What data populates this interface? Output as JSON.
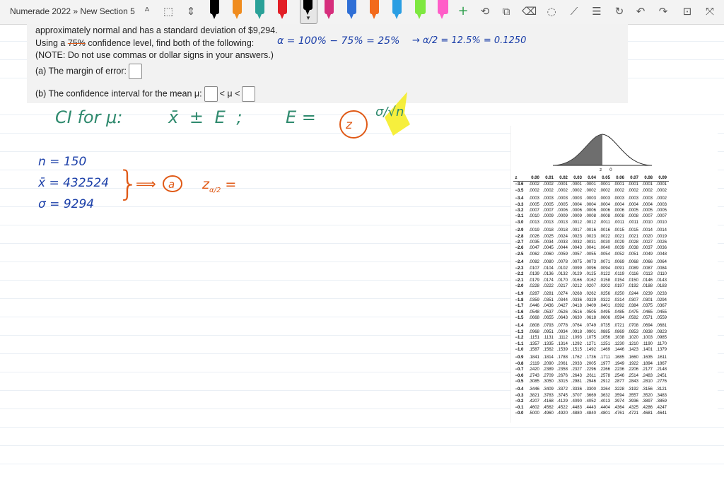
{
  "app": {
    "breadcrumb": "Numerade 2022 » New Section 5"
  },
  "toolbar": {
    "icons": [
      "lasso-text-icon",
      "lasso-select-icon",
      "insert-space-icon",
      "pen-black",
      "pen-orange",
      "pen-teal",
      "pen-red",
      "pen-blue",
      "pen-orange-2",
      "pen-gray",
      "pen-black-selected",
      "pen-red-2",
      "pen-blue-2",
      "highlighter-yellow",
      "highlighter-green",
      "highlighter-pink",
      "add-pen-icon",
      "ink-to-shape-icon",
      "ink-to-text-icon",
      "eraser-icon",
      "ruler-icon",
      "immersive-reader-icon",
      "ink-replay-icon",
      "undo-icon",
      "redo-icon",
      "ink-to-math-icon",
      "fullscreen-icon"
    ],
    "colors": {
      "pen_black": "#000000",
      "pen_orange": "#f08c1e",
      "pen_teal": "#2aa198",
      "pen_red": "#e21e26",
      "pen_blue": "#2f6fd6",
      "pen_orange2": "#f26a1b",
      "pen_gray": "#8c8c8c",
      "pen_selected": "#000000",
      "pen_red2": "#d62e7c",
      "pen_blue2": "#2a9ee3",
      "hl_yellow": "#f5ec1b",
      "hl_green": "#7ee840",
      "hl_pink": "#ff5ec8"
    }
  },
  "problem": {
    "line1": "approximately normal and has a standard deviation of $9,294.",
    "line2_pre": "Using a ",
    "line2_pct": "75%",
    "line2_post": " confidence level, find both of the following:",
    "line3": "(NOTE: Do not use commas or dollar signs in your answers.)",
    "part_a": "(a) The margin of error:",
    "part_b_pre": "(b) The confidence interval for the mean μ:",
    "lt1": "<",
    "mu": "μ",
    "lt2": "<"
  },
  "handwriting": {
    "alpha_line": "α = 100% − 75% = 25%",
    "alpha_half": "→ α/2 = 12.5% = 0.1250",
    "ci_label": "CI for μ:",
    "ci_formula": "x̄ ± E ;",
    "e_eq": "E =",
    "z_circled": "z",
    "sigma_over_root_n": "σ/√n",
    "n_line": "n = 150",
    "xbar_line": "x̄ = 432524",
    "sigma_line": "σ = 9294",
    "implies": "⟹",
    "part_a_circle": "a",
    "z_half": "z",
    "z_sub": "α/2",
    "z_eq": "="
  },
  "ztable": {
    "headers": [
      "z",
      "0.00",
      "0.01",
      "0.02",
      "0.03",
      "0.04",
      "0.05",
      "0.06",
      "0.07",
      "0.08",
      "0.09"
    ],
    "rows": [
      [
        "−3.6",
        ".0002",
        ".0002",
        ".0001",
        ".0001",
        ".0001",
        ".0001",
        ".0001",
        ".0001",
        ".0001",
        ".0001"
      ],
      [
        "−3.5",
        ".0002",
        ".0002",
        ".0002",
        ".0002",
        ".0002",
        ".0002",
        ".0002",
        ".0002",
        ".0002",
        ".0002"
      ],
      [
        "−3.4",
        ".0003",
        ".0003",
        ".0003",
        ".0003",
        ".0003",
        ".0003",
        ".0003",
        ".0003",
        ".0003",
        ".0002"
      ],
      [
        "−3.3",
        ".0005",
        ".0005",
        ".0005",
        ".0004",
        ".0004",
        ".0004",
        ".0004",
        ".0004",
        ".0004",
        ".0003"
      ],
      [
        "−3.2",
        ".0007",
        ".0007",
        ".0006",
        ".0006",
        ".0006",
        ".0006",
        ".0006",
        ".0005",
        ".0005",
        ".0005"
      ],
      [
        "−3.1",
        ".0010",
        ".0009",
        ".0009",
        ".0009",
        ".0008",
        ".0008",
        ".0008",
        ".0008",
        ".0007",
        ".0007"
      ],
      [
        "−3.0",
        ".0013",
        ".0013",
        ".0013",
        ".0012",
        ".0012",
        ".0011",
        ".0011",
        ".0011",
        ".0010",
        ".0010"
      ],
      [
        "−2.9",
        ".0019",
        ".0018",
        ".0018",
        ".0017",
        ".0016",
        ".0016",
        ".0015",
        ".0015",
        ".0014",
        ".0014"
      ],
      [
        "−2.8",
        ".0026",
        ".0025",
        ".0024",
        ".0023",
        ".0023",
        ".0022",
        ".0021",
        ".0021",
        ".0020",
        ".0019"
      ],
      [
        "−2.7",
        ".0035",
        ".0034",
        ".0033",
        ".0032",
        ".0031",
        ".0030",
        ".0029",
        ".0028",
        ".0027",
        ".0026"
      ],
      [
        "−2.6",
        ".0047",
        ".0045",
        ".0044",
        ".0043",
        ".0041",
        ".0040",
        ".0039",
        ".0038",
        ".0037",
        ".0036"
      ],
      [
        "−2.5",
        ".0062",
        ".0060",
        ".0059",
        ".0057",
        ".0055",
        ".0054",
        ".0052",
        ".0051",
        ".0049",
        ".0048"
      ],
      [
        "−2.4",
        ".0082",
        ".0080",
        ".0078",
        ".0075",
        ".0073",
        ".0071",
        ".0069",
        ".0068",
        ".0066",
        ".0064"
      ],
      [
        "−2.3",
        ".0107",
        ".0104",
        ".0102",
        ".0099",
        ".0096",
        ".0094",
        ".0091",
        ".0089",
        ".0087",
        ".0084"
      ],
      [
        "−2.2",
        ".0139",
        ".0136",
        ".0132",
        ".0129",
        ".0125",
        ".0122",
        ".0119",
        ".0116",
        ".0113",
        ".0110"
      ],
      [
        "−2.1",
        ".0179",
        ".0174",
        ".0170",
        ".0166",
        ".0162",
        ".0158",
        ".0154",
        ".0150",
        ".0146",
        ".0143"
      ],
      [
        "−2.0",
        ".0228",
        ".0222",
        ".0217",
        ".0212",
        ".0207",
        ".0202",
        ".0197",
        ".0192",
        ".0188",
        ".0183"
      ],
      [
        "−1.9",
        ".0287",
        ".0281",
        ".0274",
        ".0268",
        ".0262",
        ".0256",
        ".0250",
        ".0244",
        ".0239",
        ".0233"
      ],
      [
        "−1.8",
        ".0359",
        ".0351",
        ".0344",
        ".0336",
        ".0329",
        ".0322",
        ".0314",
        ".0307",
        ".0301",
        ".0294"
      ],
      [
        "−1.7",
        ".0446",
        ".0436",
        ".0427",
        ".0418",
        ".0409",
        ".0401",
        ".0392",
        ".0384",
        ".0375",
        ".0367"
      ],
      [
        "−1.6",
        ".0548",
        ".0537",
        ".0526",
        ".0516",
        ".0505",
        ".0495",
        ".0485",
        ".0475",
        ".0465",
        ".0455"
      ],
      [
        "−1.5",
        ".0668",
        ".0655",
        ".0643",
        ".0630",
        ".0618",
        ".0606",
        ".0594",
        ".0582",
        ".0571",
        ".0559"
      ],
      [
        "−1.4",
        ".0808",
        ".0793",
        ".0778",
        ".0764",
        ".0749",
        ".0735",
        ".0721",
        ".0708",
        ".0694",
        ".0681"
      ],
      [
        "−1.3",
        ".0968",
        ".0951",
        ".0934",
        ".0918",
        ".0901",
        ".0885",
        ".0869",
        ".0853",
        ".0838",
        ".0823"
      ],
      [
        "−1.2",
        ".1151",
        ".1131",
        ".1112",
        ".1093",
        ".1075",
        ".1056",
        ".1038",
        ".1020",
        ".1003",
        ".0985"
      ],
      [
        "−1.1",
        ".1357",
        ".1335",
        ".1314",
        ".1292",
        ".1271",
        ".1251",
        ".1230",
        ".1210",
        ".1190",
        ".1170"
      ],
      [
        "−1.0",
        ".1587",
        ".1562",
        ".1539",
        ".1515",
        ".1492",
        ".1469",
        ".1446",
        ".1423",
        ".1401",
        ".1379"
      ],
      [
        "−0.9",
        ".1841",
        ".1814",
        ".1788",
        ".1762",
        ".1736",
        ".1711",
        ".1685",
        ".1660",
        ".1635",
        ".1611"
      ],
      [
        "−0.8",
        ".2119",
        ".2090",
        ".2061",
        ".2033",
        ".2005",
        ".1977",
        ".1949",
        ".1922",
        ".1894",
        ".1867"
      ],
      [
        "−0.7",
        ".2420",
        ".2389",
        ".2358",
        ".2327",
        ".2296",
        ".2266",
        ".2236",
        ".2206",
        ".2177",
        ".2148"
      ],
      [
        "−0.6",
        ".2743",
        ".2709",
        ".2676",
        ".2643",
        ".2611",
        ".2578",
        ".2546",
        ".2514",
        ".2483",
        ".2451"
      ],
      [
        "−0.5",
        ".3085",
        ".3050",
        ".3015",
        ".2981",
        ".2946",
        ".2912",
        ".2877",
        ".2843",
        ".2810",
        ".2776"
      ],
      [
        "−0.4",
        ".3446",
        ".3409",
        ".3372",
        ".3336",
        ".3300",
        ".3264",
        ".3228",
        ".3192",
        ".3156",
        ".3121"
      ],
      [
        "−0.3",
        ".3821",
        ".3783",
        ".3745",
        ".3707",
        ".3669",
        ".3632",
        ".3594",
        ".3557",
        ".3520",
        ".3483"
      ],
      [
        "−0.2",
        ".4207",
        ".4168",
        ".4129",
        ".4090",
        ".4052",
        ".4013",
        ".3974",
        ".3936",
        ".3897",
        ".3859"
      ],
      [
        "−0.1",
        ".4602",
        ".4562",
        ".4522",
        ".4483",
        ".4443",
        ".4404",
        ".4364",
        ".4325",
        ".4286",
        ".4247"
      ],
      [
        "−0.0",
        ".5000",
        ".4960",
        ".4920",
        ".4880",
        ".4840",
        ".4801",
        ".4761",
        ".4721",
        ".4681",
        ".4641"
      ]
    ],
    "curve_labels": [
      "z",
      "0"
    ]
  }
}
